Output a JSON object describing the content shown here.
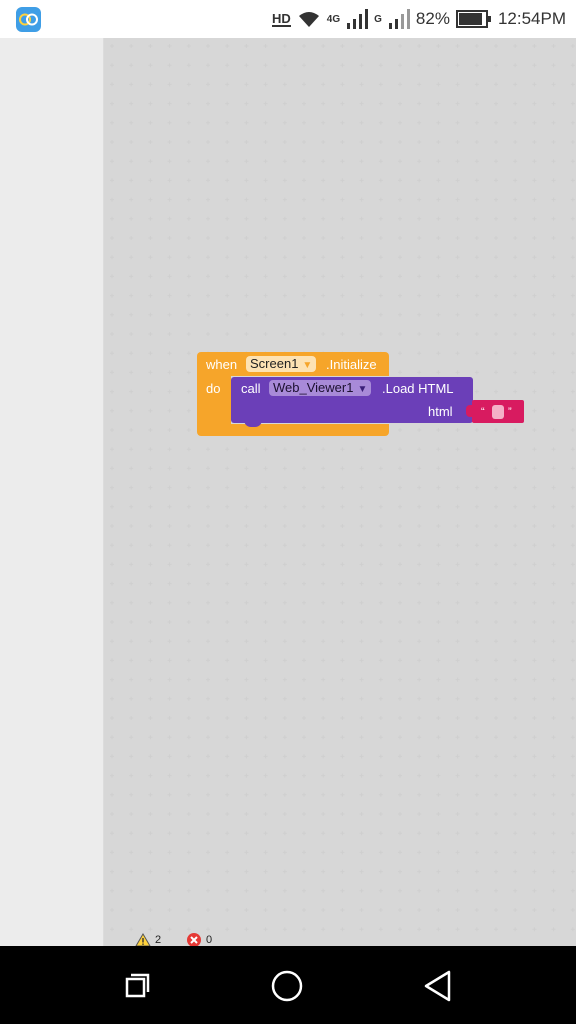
{
  "status_bar": {
    "hd": "HD",
    "net_4g": "4G",
    "net_g": "G",
    "battery": "82%",
    "time": "12:54PM"
  },
  "blocks": {
    "event": {
      "when_label": "when",
      "component": "Screen1",
      "event_name": ".Initialize",
      "do_label": "do"
    },
    "call": {
      "call_label": "call",
      "component": "Web_Viewer1",
      "method": ".Load HTML",
      "param_label": "html"
    },
    "text_string": {
      "open_quote": "“",
      "value": "",
      "close_quote": "”"
    },
    "dropdown_arrow": "▼"
  },
  "indicators": {
    "warnings": "2",
    "errors": "0"
  },
  "colors": {
    "event_block": "#f6a52a",
    "call_block": "#6b3fb8",
    "text_block": "#d81b60"
  },
  "icons": {
    "warning": "warning-triangle-icon",
    "error": "error-x-icon",
    "back": "back-triangle-icon",
    "home": "home-circle-icon",
    "recent": "recent-apps-square-icon"
  }
}
